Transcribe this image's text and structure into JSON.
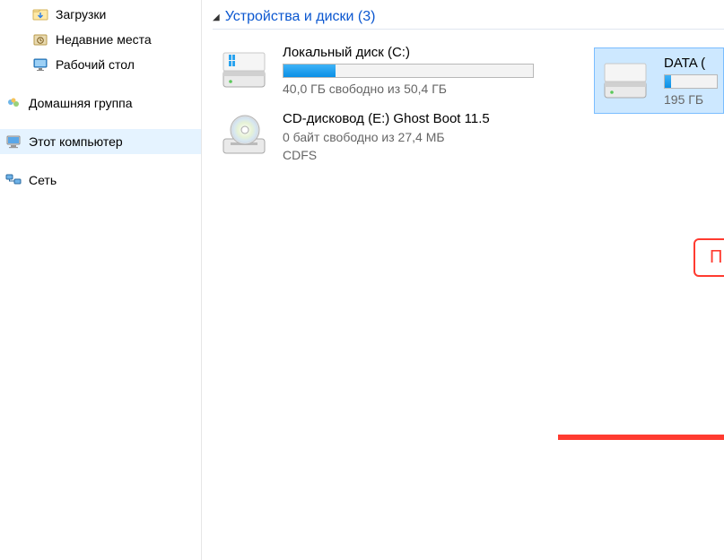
{
  "sidebar": {
    "items": [
      {
        "label": "Загрузки",
        "icon": "downloads"
      },
      {
        "label": "Недавние места",
        "icon": "recent"
      },
      {
        "label": "Рабочий стол",
        "icon": "desktop"
      }
    ],
    "homegroup": {
      "label": "Домашняя группа"
    },
    "thispc": {
      "label": "Этот компьютер"
    },
    "network": {
      "label": "Сеть"
    }
  },
  "section": {
    "title": "Устройства и диски (3)"
  },
  "drives": {
    "c": {
      "title": "Локальный диск (C:)",
      "free": "40,0 ГБ свободно из 50,4 ГБ",
      "fill_pct": 21
    },
    "e": {
      "title": "CD-дисковод (E:) Ghost Boot 11.5",
      "free": "0 байт свободно из 27,4 МБ",
      "fs": "CDFS"
    },
    "data": {
      "title": "DATA (",
      "free": "195 ГБ",
      "fill_pct": 12
    }
  },
  "callout": {
    "label": "ПКМ"
  }
}
